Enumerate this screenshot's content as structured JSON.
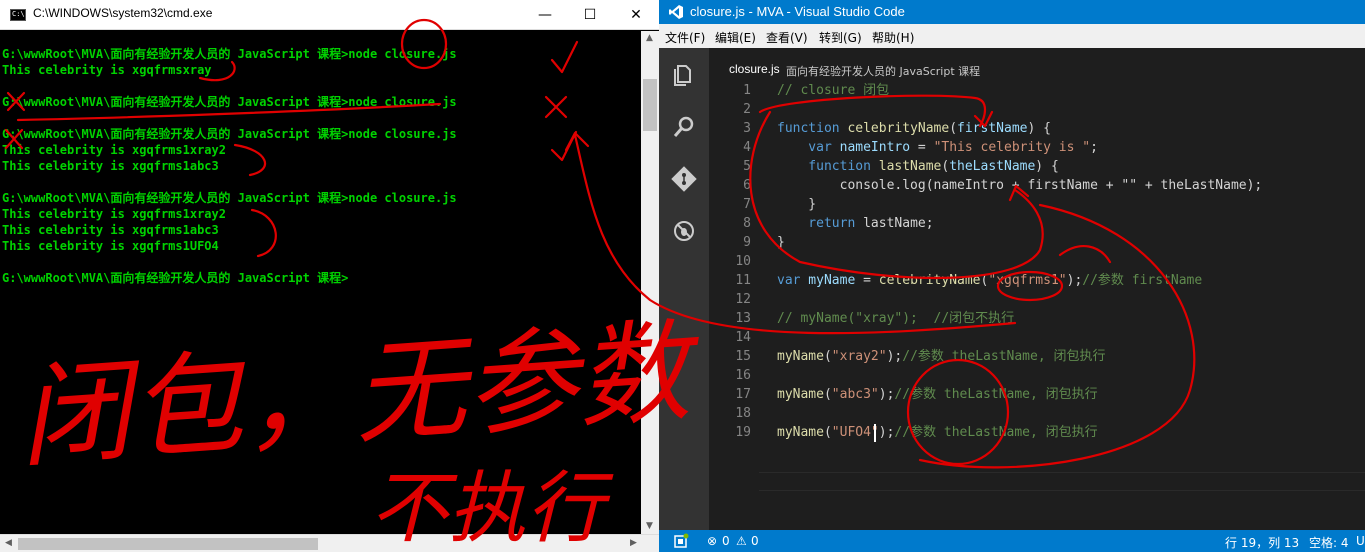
{
  "cmd": {
    "title": "C:\\WINDOWS\\system32\\cmd.exe",
    "controls": {
      "minimize": "—",
      "maximize": "☐",
      "close": "✕"
    },
    "lines": [
      "G:\\wwwRoot\\MVA\\面向有经验开发人员的 JavaScript 课程>node closure.js",
      "This celebrity is xgqfrmsxray",
      "",
      "G:\\wwwRoot\\MVA\\面向有经验开发人员的 JavaScript 课程>node closure.js",
      "",
      "G:\\wwwRoot\\MVA\\面向有经验开发人员的 JavaScript 课程>node closure.js",
      "This celebrity is xgqfrms1xray2",
      "This celebrity is xgqfrms1abc3",
      "",
      "G:\\wwwRoot\\MVA\\面向有经验开发人员的 JavaScript 课程>node closure.js",
      "This celebrity is xgqfrms1xray2",
      "This celebrity is xgqfrms1abc3",
      "This celebrity is xgqfrms1UFO4",
      "",
      "G:\\wwwRoot\\MVA\\面向有经验开发人员的 JavaScript 课程>"
    ]
  },
  "vscode": {
    "title": "closure.js - MVA - Visual Studio Code",
    "menu": [
      "文件(F)",
      "编辑(E)",
      "查看(V)",
      "转到(G)",
      "帮助(H)"
    ],
    "tab": {
      "file": "closure.js",
      "path": "面向有经验开发人员的 JavaScript 课程"
    },
    "line_numbers": [
      "1",
      "2",
      "3",
      "4",
      "5",
      "6",
      "7",
      "8",
      "9",
      "10",
      "11",
      "12",
      "13",
      "14",
      "15",
      "16",
      "17",
      "18",
      "19"
    ],
    "code": {
      "l1": "// closure 闭包",
      "l3": [
        "function",
        " celebrityName",
        "(",
        "firstName",
        ") {"
      ],
      "l4": [
        "    var",
        " nameIntro",
        " = ",
        "\"This celebrity is \"",
        ";"
      ],
      "l5": [
        "    function",
        " lastName",
        "(",
        "theLastName",
        ") {"
      ],
      "l6": "        console.log(nameIntro + firstName + \"\" + theLastName);",
      "l7": "    }",
      "l8": [
        "    return",
        " lastName;"
      ],
      "l9": "}",
      "l11": [
        "var",
        " myName",
        " = ",
        "celebrityName",
        "(",
        "\"xgqfrms1\"",
        ");",
        "//参数 firstName"
      ],
      "l13": "// myName(\"xray\");  //闭包不执行",
      "l15": [
        "myName",
        "(",
        "\"xray2\"",
        ");",
        "//参数 theLastName, 闭包执行"
      ],
      "l17": [
        "myName",
        "(",
        "\"abc3\"",
        ");",
        "//参数 theLastName, 闭包执行"
      ],
      "l19": [
        "myName",
        "(",
        "\"UFO4\"",
        ");",
        "//参数 theLastName, 闭包执行"
      ]
    },
    "status": {
      "errors": "0",
      "warnings": "0",
      "position": "行 19，列 13",
      "spaces": "空格: 4",
      "extra": "U"
    }
  },
  "annotations": {
    "handwriting": [
      "闭包，无参数",
      "不执行"
    ]
  }
}
